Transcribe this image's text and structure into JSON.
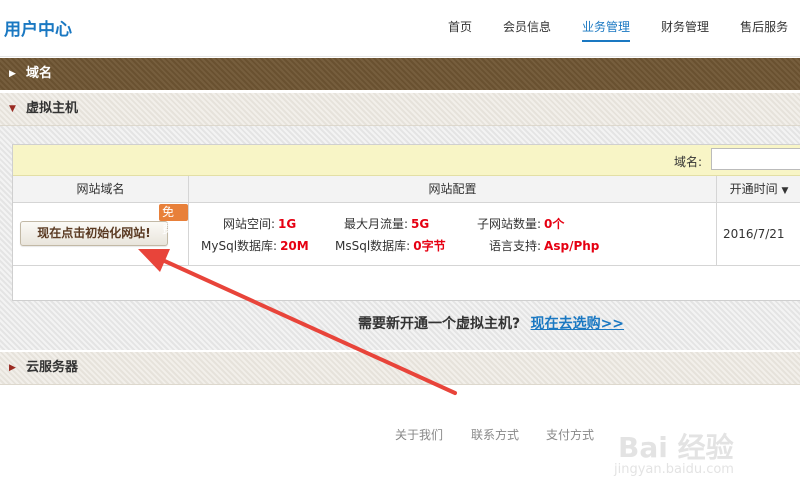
{
  "header": {
    "brand": "用户中心",
    "nav": [
      {
        "label": "首页",
        "active": false
      },
      {
        "label": "会员信息",
        "active": false
      },
      {
        "label": "业务管理",
        "active": true
      },
      {
        "label": "财务管理",
        "active": false
      },
      {
        "label": "售后服务",
        "active": false
      }
    ]
  },
  "sections": {
    "domain": {
      "label": "域名",
      "icon": "triangle-right-icon"
    },
    "vhost": {
      "label": "虚拟主机",
      "icon": "triangle-down-icon"
    },
    "cloud": {
      "label": "云服务器",
      "icon": "triangle-right-icon"
    }
  },
  "vhost": {
    "search": {
      "label": "域名:",
      "value": "",
      "placeholder": ""
    },
    "columns": {
      "domain": "网站域名",
      "config": "网站配置",
      "time": "开通时间",
      "sort_icon": "sort-down-icon"
    },
    "row": {
      "init_button": "现在点击初始化网站!",
      "free_badge": "免费",
      "specs": [
        {
          "key": "网站空间:",
          "value": "1G"
        },
        {
          "key": "最大月流量:",
          "value": "5G"
        },
        {
          "key": "子网站数量:",
          "value": "0个"
        },
        {
          "key": "MySql数据库:",
          "value": "20M"
        },
        {
          "key": "MsSql数据库:",
          "value": "0字节"
        },
        {
          "key": "语言支持:",
          "value": "Asp/Php"
        }
      ],
      "open_time": "2016/7/21"
    },
    "promo": {
      "text": "需要新开通一个虚拟主机?",
      "link": "现在去选购>>"
    }
  },
  "footer": {
    "links": [
      "关于我们",
      "联系方式",
      "支付方式"
    ]
  },
  "annotation": {
    "color": "#e8443a",
    "type": "arrow"
  },
  "watermark": {
    "main": "Bai 经验",
    "sub": "jingyan.baidu.com"
  },
  "colors": {
    "accent": "#1a78c2",
    "domain_bar": "#6f5533",
    "value_red": "#e60012",
    "badge": "#e8803a"
  }
}
